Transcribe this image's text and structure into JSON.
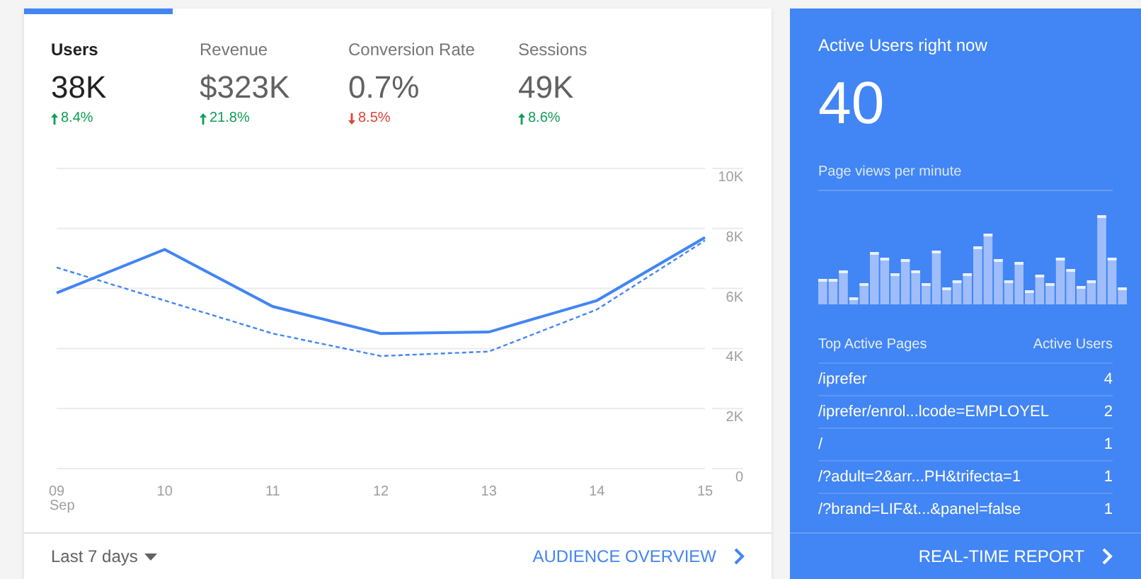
{
  "metric_tabs": [
    {
      "label": "Users",
      "value": "38K",
      "change": "8.4%",
      "decrease": false,
      "selected": true
    },
    {
      "label": "Revenue",
      "value": "$323K",
      "change": "21.8%",
      "decrease": false,
      "selected": false
    },
    {
      "label": "Conversion Rate",
      "value": "0.7%",
      "change": "8.5%",
      "decrease": true,
      "selected": false
    },
    {
      "label": "Sessions",
      "value": "49K",
      "change": "8.6%",
      "decrease": false,
      "selected": false
    }
  ],
  "chart_data": {
    "type": "line",
    "categories": [
      "09",
      "10",
      "11",
      "12",
      "13",
      "14",
      "15"
    ],
    "annotations": [
      "Sep"
    ],
    "grid": true,
    "ylim": [
      0,
      10000
    ],
    "yticks": [
      {
        "value": 10000,
        "label": "10K"
      },
      {
        "value": 8000,
        "label": "8K"
      },
      {
        "value": 6000,
        "label": "6K"
      },
      {
        "value": 4000,
        "label": "4K"
      },
      {
        "value": 2000,
        "label": "2K"
      },
      {
        "value": 0,
        "label": "0"
      }
    ],
    "series": [
      {
        "color": "#4285f4",
        "line_style": "solid",
        "values": [
          5850,
          7300,
          5400,
          4500,
          4550,
          5600,
          7700
        ]
      },
      {
        "color": "#4285f4",
        "line_style": "dashed",
        "values": [
          6700,
          5600,
          4500,
          3750,
          3900,
          5300,
          7600
        ]
      }
    ]
  },
  "date_range": "Last 7 days",
  "overview_link": "AUDIENCE OVERVIEW",
  "realtime": {
    "title": "Active Users right now",
    "count": "40",
    "subtitle": "Page views per minute",
    "pages_header": "Top Active Pages",
    "users_header": "Active Users",
    "pages": [
      {
        "page": "/iprefer",
        "users": "4"
      },
      {
        "page": "/iprefer/enrol...lcode=EMPLOYEL",
        "users": "2"
      },
      {
        "page": "/",
        "users": "1"
      },
      {
        "page": "/?adult=2&arr...PH&trifecta=1",
        "users": "1"
      },
      {
        "page": "/?brand=LIF&t...&panel=false",
        "users": "1"
      }
    ],
    "report_link": "REAL-TIME REPORT"
  }
}
